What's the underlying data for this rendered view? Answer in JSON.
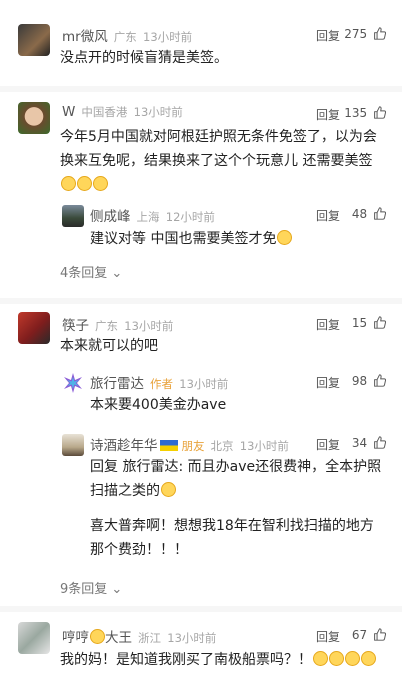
{
  "ui": {
    "reply_label": "回复",
    "more_suffix": "⌄"
  },
  "comments": [
    {
      "name": "mr微风",
      "location": "广东",
      "time": "13小时前",
      "likes": "275",
      "text": "没点开的时候盲猜是美签。"
    },
    {
      "name": "W",
      "location": "中国香港",
      "time": "13小时前",
      "likes": "135",
      "text": "今年5月中国就对阿根廷护照无条件免签了，以为会换来互免呢，结果换来了这个个玩意儿 还需要美签",
      "replies": [
        {
          "name": "侧成峰",
          "location": "上海",
          "time": "12小时前",
          "likes": "48",
          "text": "建议对等 中国也需要美签才免"
        }
      ],
      "more": "4条回复"
    },
    {
      "name": "筷子",
      "location": "广东",
      "time": "13小时前",
      "likes": "15",
      "text": "本来就可以的吧",
      "replies": [
        {
          "name": "旅行雷达",
          "tag": "作者",
          "time": "13小时前",
          "likes": "98",
          "text": "本来要400美金办ave"
        },
        {
          "name": "诗酒趁年华",
          "tag": "朋友",
          "location": "北京",
          "time": "13小时前",
          "likes": "34",
          "text1": "回复 旅行雷达: 而且办ave还很费神，全本护照扫描之类的",
          "text2": "喜大普奔啊！想想我18年在智利找扫描的地方那个费劲！！！"
        }
      ],
      "more": "9条回复"
    },
    {
      "name": "哼哼",
      "name_suffix": "大王",
      "location": "浙江",
      "time": "13小时前",
      "likes": "67",
      "text": "我的妈！是知道我刚买了南极船票吗？！"
    }
  ]
}
